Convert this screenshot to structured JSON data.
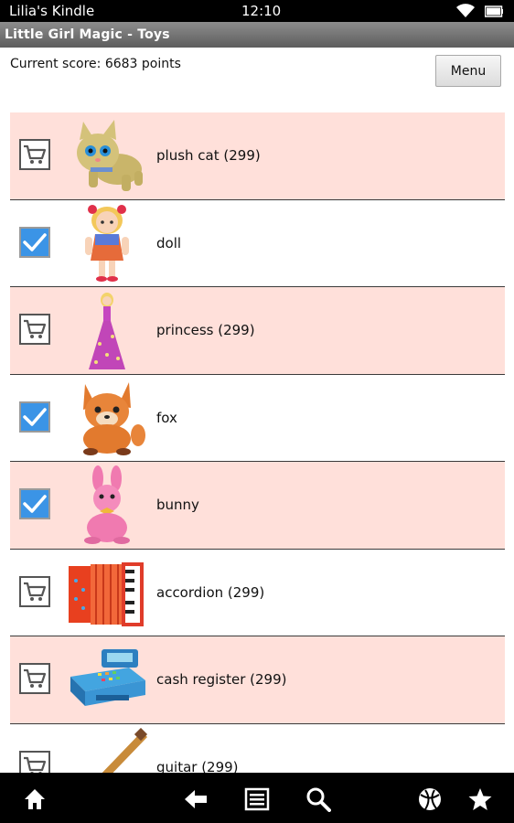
{
  "status_bar": {
    "device_name": "Lilia's Kindle",
    "time": "12:10"
  },
  "title_bar": {
    "title": "Little Girl Magic - Toys"
  },
  "score": {
    "text": "Current score: 6683 points"
  },
  "menu": {
    "label": "Menu"
  },
  "items": [
    {
      "label": "plush cat (299)",
      "owned": false,
      "toy": "plush-cat"
    },
    {
      "label": "doll",
      "owned": true,
      "toy": "doll"
    },
    {
      "label": "princess (299)",
      "owned": false,
      "toy": "princess"
    },
    {
      "label": "fox",
      "owned": true,
      "toy": "fox"
    },
    {
      "label": "bunny",
      "owned": true,
      "toy": "bunny"
    },
    {
      "label": "accordion (299)",
      "owned": false,
      "toy": "accordion"
    },
    {
      "label": "cash register (299)",
      "owned": false,
      "toy": "cash-register"
    },
    {
      "label": "guitar (299)",
      "owned": false,
      "toy": "guitar"
    }
  ],
  "colors": {
    "row_highlight": "#ffe0da",
    "check_blue": "#3b94e6",
    "bar_black": "#000000"
  },
  "nav_icons": [
    "home-icon",
    "back-icon",
    "menu-list-icon",
    "search-icon",
    "ball-icon",
    "favorites-star-icon"
  ]
}
